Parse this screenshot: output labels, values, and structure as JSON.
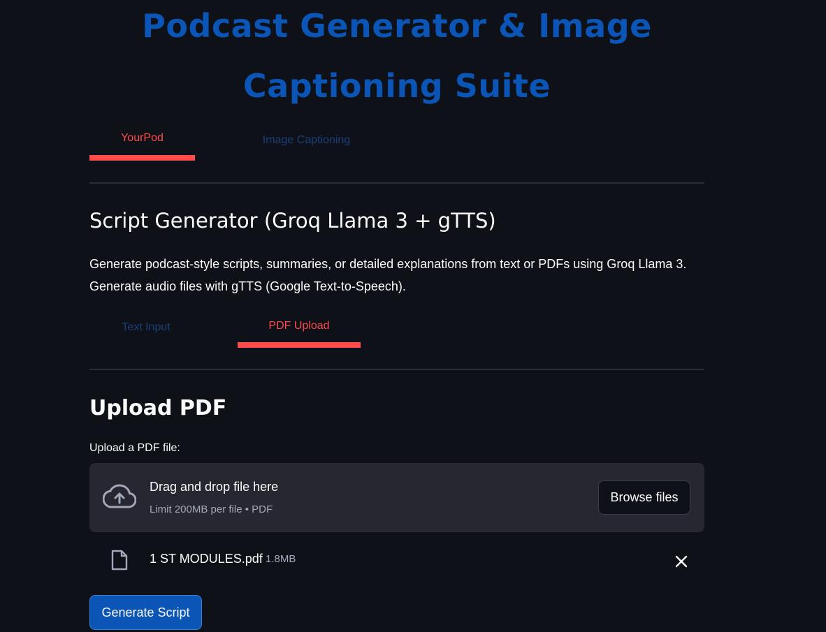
{
  "app": {
    "title_line1": "Podcast Generator & Image",
    "title_line2": "Captioning Suite"
  },
  "main_tabs": [
    {
      "label": "YourPod",
      "active": true
    },
    {
      "label": "Image Captioning",
      "active": false
    }
  ],
  "script_generator": {
    "heading": "Script Generator (Groq Llama 3 + gTTS)",
    "description_line1": "Generate podcast-style scripts, summaries, or detailed explanations from text or PDFs using Groq Llama 3.",
    "description_line2": "Generate audio files with gTTS (Google Text-to-Speech)."
  },
  "input_tabs": [
    {
      "label": "Text Input",
      "active": false
    },
    {
      "label": "PDF Upload",
      "active": true
    }
  ],
  "upload": {
    "heading": "Upload PDF",
    "field_label": "Upload a PDF file:",
    "dropzone_title": "Drag and drop file here",
    "dropzone_subtitle": "Limit 200MB per file • PDF",
    "dropzone_icon": "cloud-upload-icon",
    "browse_label": "Browse files"
  },
  "uploaded_file": {
    "icon": "file-icon",
    "name": "1 ST MODULES.pdf",
    "size": "1.8MB",
    "remove_icon": "close-icon"
  },
  "actions": {
    "generate_label": "Generate Script"
  },
  "colors": {
    "background": "#0e1117",
    "title": "#0b55b7",
    "active_tab": "#ff4b4b",
    "inactive_tab": "#1c3f7a",
    "dropzone": "#262730",
    "primary_button": "#0b55b7"
  }
}
